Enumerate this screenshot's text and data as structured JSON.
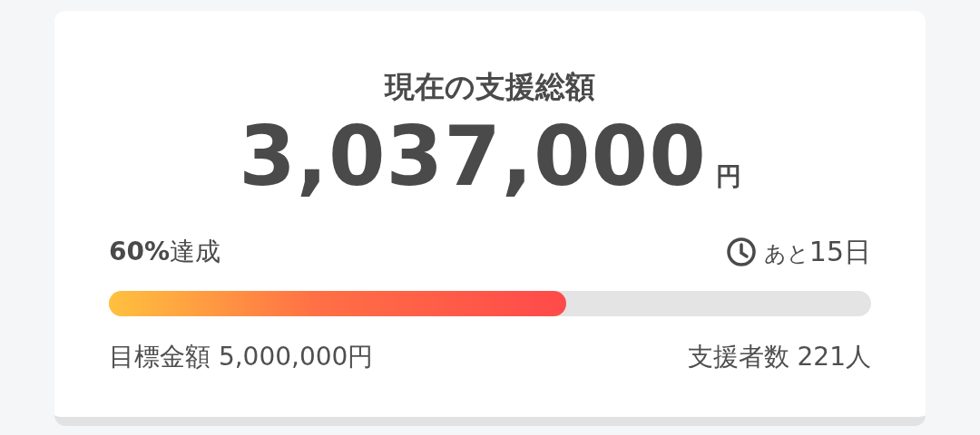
{
  "title": "現在の支援総額",
  "amount": {
    "value": "3,037,000",
    "unit": "円"
  },
  "achievement": "**60%**達成",
  "days_left": {
    "prefix": "あと",
    "value": "15日"
  },
  "progress": {
    "level": 0.6
  },
  "goal": "目標金額 5,000,000円",
  "supporters": "支援者数 221人"
}
